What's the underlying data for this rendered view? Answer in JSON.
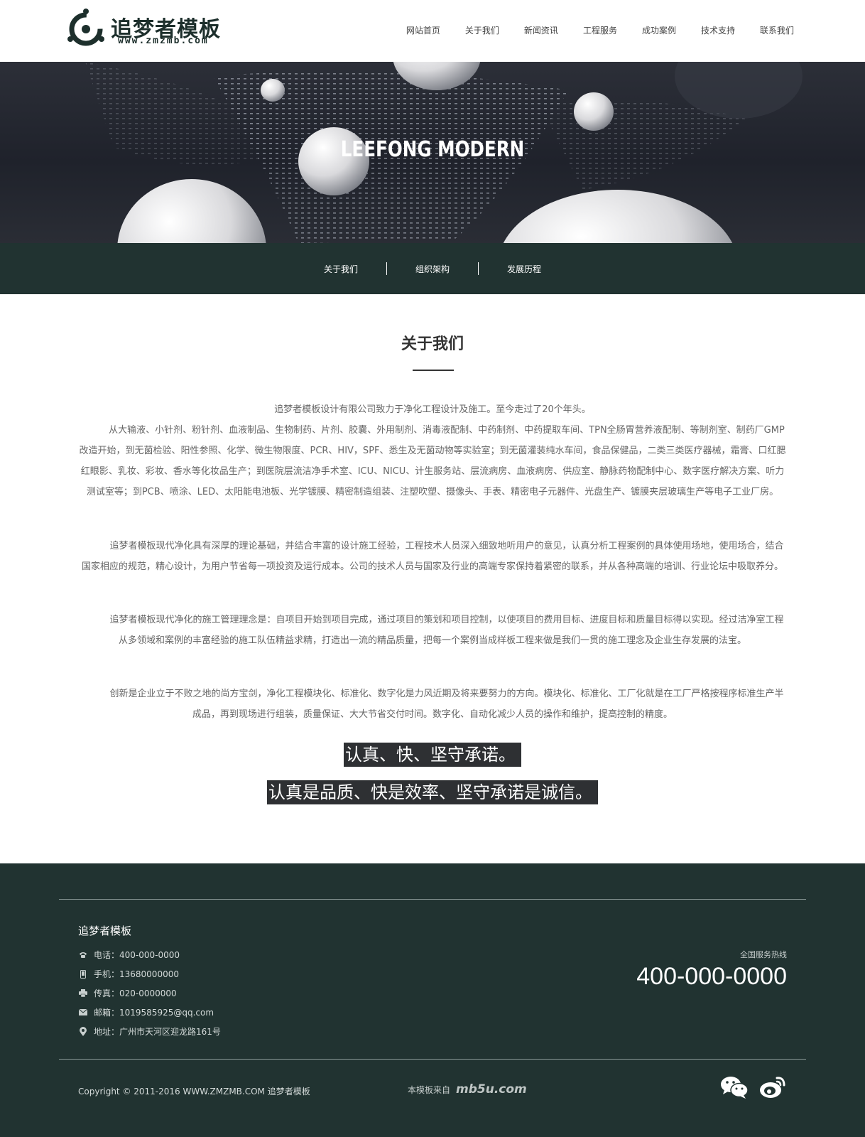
{
  "header": {
    "logo_title": "追梦者模板",
    "logo_sub": "www.zmzmb.com",
    "nav": [
      "网站首页",
      "关于我们",
      "新闻资讯",
      "工程服务",
      "成功案例",
      "技术支持",
      "联系我们"
    ]
  },
  "banner": {
    "title": "LEEFONG MODERN"
  },
  "subnav": [
    "关于我们",
    "组织架构",
    "发展历程"
  ],
  "content": {
    "title": "关于我们",
    "p1_line1": "追梦者模板设计有限公司致力于净化工程设计及施工。至今走过了20个年头。",
    "p1_line2": "从大输液、小针剂、粉针剂、血液制品、生物制药、片剂、胶囊、外用制剂、消毒液配制、中药制剂、中药提取车间、TPN全肠胃营养液配制、等制剂室、制药厂GMP改造开始，到无菌检验、阳性参照、化学、微生物限度、PCR、HIV，SPF、悉生及无菌动物等实验室；到无菌灌装纯水车间，食品保健品，二类三类医疗器械，霜膏、口红腮红眼影、乳妆、彩妆、香水等化妆品生产；到医院层流洁净手术室、ICU、NICU、计生服务站、层流病房、血液病房、供应室、静脉药物配制中心、数字医疗解决方案、听力测试室等；到PCB、喷涂、LED、太阳能电池板、光学镀膜、精密制造组装、注塑吹塑、摄像头、手表、精密电子元器件、光盘生产、镀膜夹层玻璃生产等电子工业厂房。",
    "p2": "追梦者模板现代净化具有深厚的理论基础，并结合丰富的设计施工经验，工程技术人员深入细致地听用户的意见，认真分析工程案例的具体使用场地，使用场合，结合国家相应的规范，精心设计，为用户节省每一项投资及运行成本。公司的技术人员与国家及行业的高端专家保持着紧密的联系，并从各种高端的培训、行业论坛中吸取养分。",
    "p3": "追梦者模板现代净化的施工管理理念是：自项目开始到项目完成，通过项目的策划和项目控制，以使项目的费用目标、进度目标和质量目标得以实现。经过洁净室工程从多领域和案例的丰富经验的施工队伍精益求精，打造出一流的精品质量，把每一个案例当成样板工程来做是我们一贯的施工理念及企业生存发展的法宝。",
    "p4": "创新是企业立于不败之地的尚方宝剑，净化工程模块化、标准化、数字化是力风近期及将来要努力的方向。模块化、标准化、工厂化就是在工厂严格按程序标准生产半成品，再到现场进行组装，质量保证、大大节省交付时间。数字化、自动化减少人员的操作和维护，提高控制的精度。",
    "highlight1": "认真、快、坚守承诺。",
    "highlight2": "认真是品质、快是效率、坚守承诺是诚信。"
  },
  "footer": {
    "company": "追梦者模板",
    "items": [
      {
        "icon": "phone-icon",
        "text": "电话：400-000-0000"
      },
      {
        "icon": "mobile-icon",
        "text": "手机：13680000000"
      },
      {
        "icon": "fax-icon",
        "text": "传真：020-0000000"
      },
      {
        "icon": "mail-icon",
        "text": "邮箱：1019585925@qq.com"
      },
      {
        "icon": "location-icon",
        "text": "地址：广州市天河区迎龙路161号"
      }
    ],
    "hotline_label": "全国服务热线",
    "hotline": "400-000-0000",
    "copyright": "Copyright © 2011-2016 WWW.ZMZMB.COM 追梦者模板",
    "credit_text": "本模板来自",
    "credit_brand": "mb5u.com",
    "social": [
      "wechat-icon",
      "weibo-icon"
    ]
  },
  "colors": {
    "dark_green": "#213331",
    "highlight_bg": "#2e3033",
    "text_gray": "#666666"
  }
}
